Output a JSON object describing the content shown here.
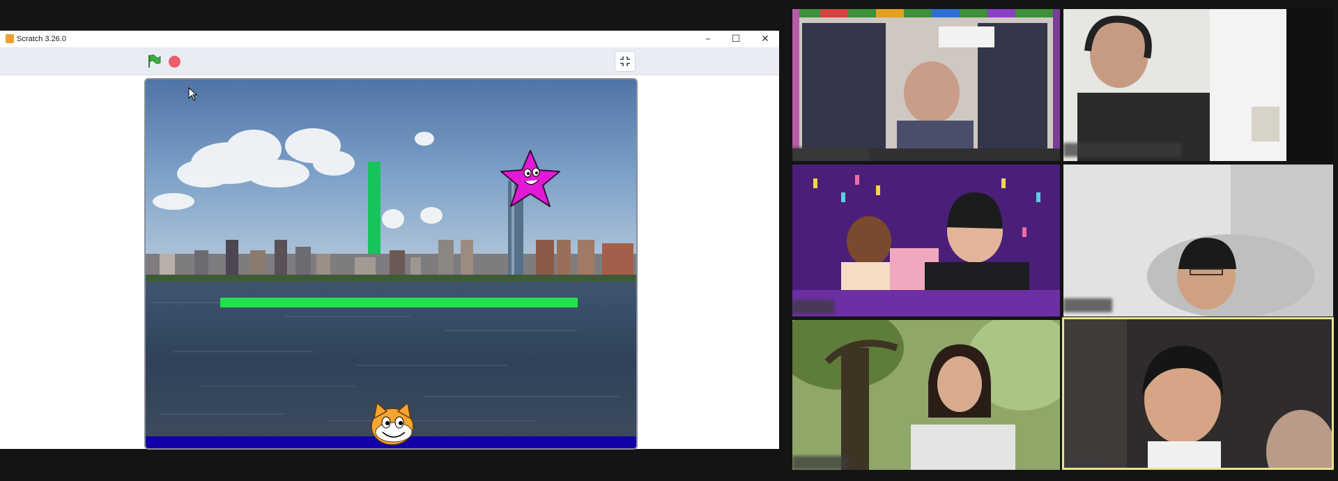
{
  "scratch": {
    "window_title": "Scratch 3.26.0",
    "controls": {
      "minimize": "–",
      "maximize": "☐",
      "close": "✕"
    },
    "toolbar": {
      "green_flag": "green-flag-icon",
      "stop": "stop-icon",
      "fullscreen": "shrink-icon"
    },
    "stage": {
      "backdrop": "city skyline over water",
      "sprites": [
        "cat",
        "star",
        "green-vertical-bar",
        "green-horizontal-bar",
        "blue-ground"
      ]
    }
  },
  "video_call": {
    "participant_count": 6,
    "active_speaker_border_color": "#e7e58a"
  },
  "colors": {
    "green_bar": "#1fe34a",
    "ground": "#1200a8",
    "star": "#e21ad7",
    "window_bg": "#141414"
  }
}
